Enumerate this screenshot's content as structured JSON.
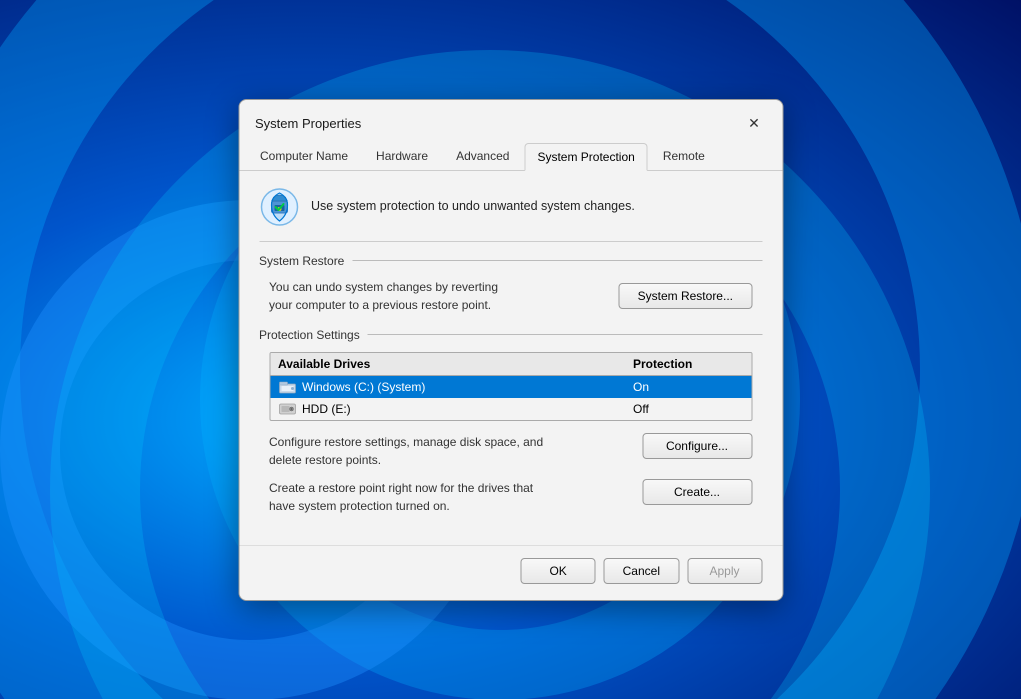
{
  "wallpaper": {
    "alt": "Windows 11 blue wallpaper"
  },
  "dialog": {
    "title": "System Properties",
    "close_label": "✕",
    "tabs": [
      {
        "id": "computer-name",
        "label": "Computer Name",
        "active": false
      },
      {
        "id": "hardware",
        "label": "Hardware",
        "active": false
      },
      {
        "id": "advanced",
        "label": "Advanced",
        "active": false
      },
      {
        "id": "system-protection",
        "label": "System Protection",
        "active": true
      },
      {
        "id": "remote",
        "label": "Remote",
        "active": false
      }
    ],
    "header": {
      "icon_alt": "system protection icon",
      "description": "Use system protection to undo unwanted system changes."
    },
    "system_restore": {
      "section_label": "System Restore",
      "description": "You can undo system changes by reverting\nyour computer to a previous restore point.",
      "button_label": "System Restore..."
    },
    "protection_settings": {
      "section_label": "Protection Settings",
      "columns": {
        "drive": "Available Drives",
        "protection": "Protection"
      },
      "drives": [
        {
          "name": "Windows (C:) (System)",
          "protection": "On",
          "selected": true,
          "icon": "system-drive"
        },
        {
          "name": "HDD (E:)",
          "protection": "Off",
          "selected": false,
          "icon": "hdd-drive"
        }
      ],
      "configure": {
        "description": "Configure restore settings, manage disk space, and\ndelete restore points.",
        "button_label": "Configure..."
      },
      "create": {
        "description": "Create a restore point right now for the drives that\nhave system protection turned on.",
        "button_label": "Create..."
      }
    },
    "footer": {
      "ok_label": "OK",
      "cancel_label": "Cancel",
      "apply_label": "Apply"
    }
  }
}
